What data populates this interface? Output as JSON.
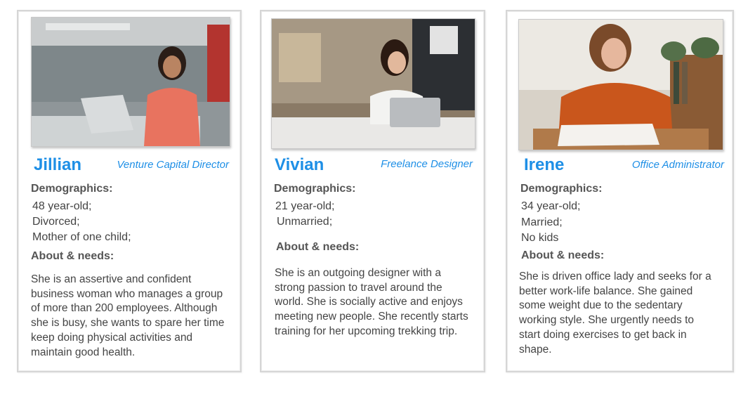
{
  "personas": [
    {
      "name": "Jillian",
      "role": "Venture Capital Director",
      "demographics_label": "Demographics:",
      "demographics": [
        "48 year-old;",
        "Divorced;",
        "Mother of one child;"
      ],
      "about_label": "About & needs:",
      "about": "She is an assertive and confident business woman who manages a group of more than 200 employees. Although she is busy, she wants to spare her time keep doing physical activities and maintain good health."
    },
    {
      "name": "Vivian",
      "role": "Freelance Designer",
      "demographics_label": "Demographics:",
      "demographics": [
        "21 year-old;",
        "Unmarried;"
      ],
      "about_label": "About & needs:",
      "about": "She is an outgoing designer with a strong passion to travel around the world.  She is socially active and enjoys meeting new people. She recently starts training for her upcoming trekking trip."
    },
    {
      "name": "Irene",
      "role": "Office Administrator",
      "demographics_label": "Demographics:",
      "demographics": [
        "34 year-old;",
        "Married;",
        "No kids"
      ],
      "about_label": "About & needs:",
      "about": "She is driven office lady and seeks for a better work-life balance. She gained some weight due to the sedentary working style. She urgently needs to start doing exercises to get back in shape."
    }
  ],
  "colors": {
    "accent": "#1e8fe6",
    "text": "#444444",
    "label": "#555555",
    "border": "#d6d6d6"
  }
}
